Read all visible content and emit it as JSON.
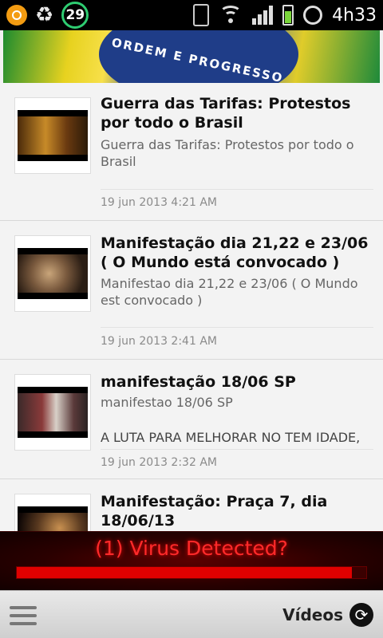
{
  "status_bar": {
    "time": "4h33",
    "badge_number": "29",
    "icons": [
      "orange-app-icon",
      "recycle-icon",
      "battery-saver-badge-icon",
      "vibrate-icon",
      "wifi-icon",
      "signal-icon",
      "battery-icon",
      "alarm-icon"
    ]
  },
  "banner": {
    "text": "ORDEM E PROGRESSO"
  },
  "feed": {
    "items": [
      {
        "title": "Guerra das Tarifas: Protestos por todo o Brasil",
        "description": "Guerra das Tarifas: Protestos por todo o Brasil",
        "extra": "",
        "date": "19 jun 2013 4:21 AM"
      },
      {
        "title": "Manifestação dia 21,22 e 23/06 ( O Mundo está convocado )",
        "description": "Manifestao dia 21,22 e 23/06 ( O Mundo est convocado )",
        "extra": "",
        "date": "19 jun 2013 2:41 AM"
      },
      {
        "title": "manifestação 18/06 SP",
        "description": "manifestao 18/06 SP",
        "extra": "A LUTA PARA MELHORAR NO TEM IDADE,",
        "date": "19 jun 2013 2:32 AM"
      },
      {
        "title": "Manifestação: Praça 7, dia 18/06/13",
        "description": "",
        "extra": "",
        "date": ""
      }
    ]
  },
  "ad": {
    "text": "(1) Virus Detected?",
    "progress": 0.96
  },
  "bottom_bar": {
    "label": "Vídeos"
  }
}
